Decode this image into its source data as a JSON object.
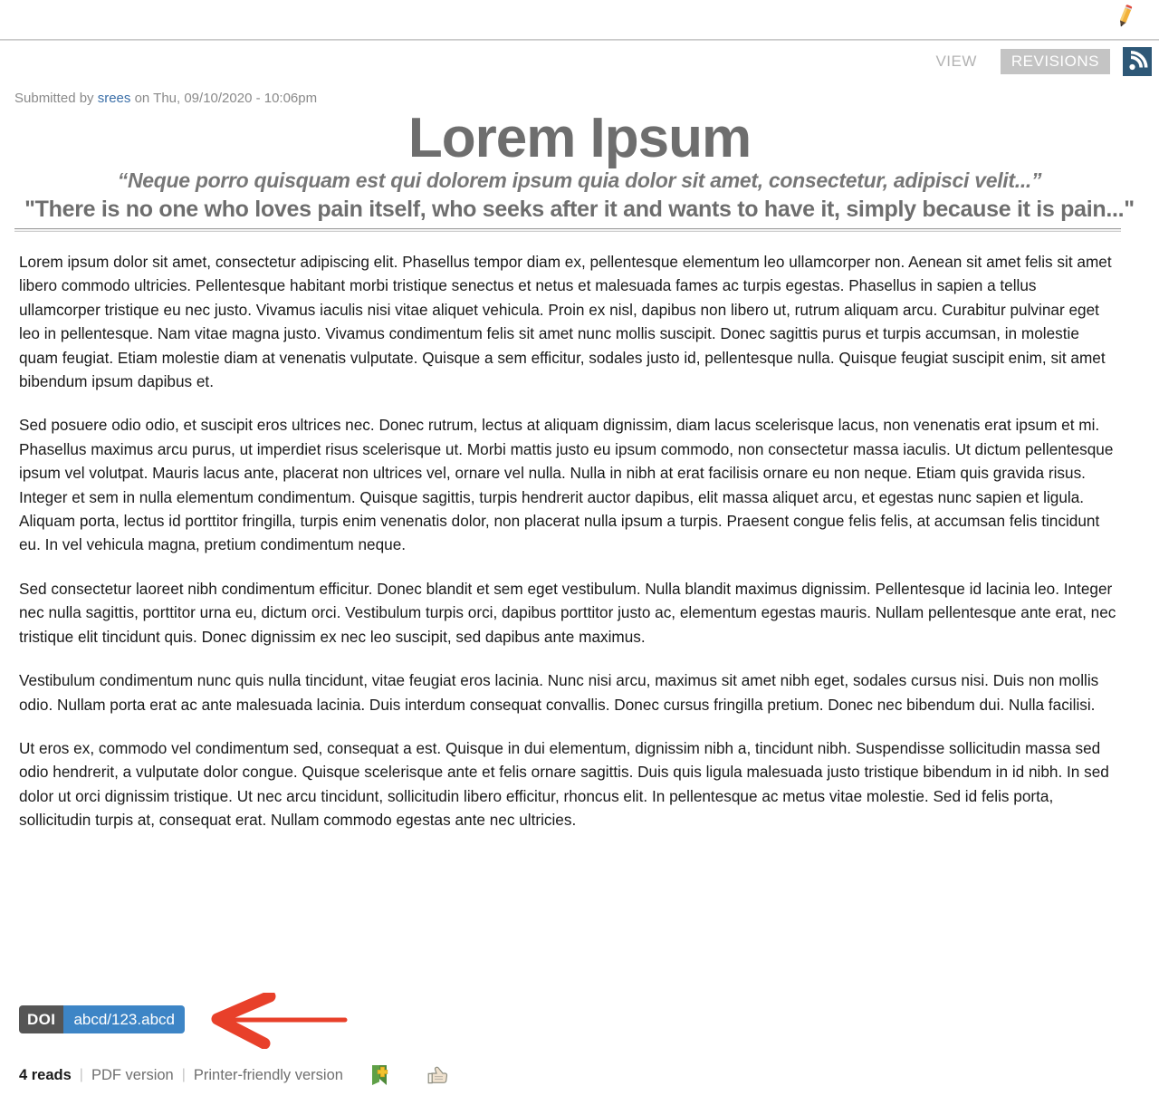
{
  "toolbar": {
    "edit_icon": "pencil-icon"
  },
  "tabs": [
    {
      "label": "VIEW",
      "active": false
    },
    {
      "label": "REVISIONS",
      "active": true
    }
  ],
  "rss": {
    "icon": "rss-icon"
  },
  "meta": {
    "submitted_prefix": "Submitted by ",
    "author": "srees",
    "submitted_suffix": " on Thu, 09/10/2020 - 10:06pm"
  },
  "article": {
    "title": "Lorem Ipsum",
    "subtitle_1": "“Neque porro quisquam est qui dolorem ipsum quia dolor sit amet, consectetur, adipisci velit...”",
    "subtitle_2": "\"There is no one who loves pain itself, who seeks after it and wants to have it, simply because it is pain...\"",
    "paragraphs": [
      "Lorem ipsum dolor sit amet, consectetur adipiscing elit. Phasellus tempor diam ex, pellentesque elementum leo ullamcorper non. Aenean sit amet felis sit amet libero commodo ultricies. Pellentesque habitant morbi tristique senectus et netus et malesuada fames ac turpis egestas. Phasellus in sapien a tellus ullamcorper tristique eu nec justo. Vivamus iaculis nisi vitae aliquet vehicula. Proin ex nisl, dapibus non libero ut, rutrum aliquam arcu. Curabitur pulvinar eget leo in pellentesque. Nam vitae magna justo. Vivamus condimentum felis sit amet nunc mollis suscipit. Donec sagittis purus et turpis accumsan, in molestie quam feugiat. Etiam molestie diam at venenatis vulputate. Quisque a sem efficitur, sodales justo id, pellentesque nulla. Quisque feugiat suscipit enim, sit amet bibendum ipsum dapibus et.",
      "Sed posuere odio odio, et suscipit eros ultrices nec. Donec rutrum, lectus at aliquam dignissim, diam lacus scelerisque lacus, non venenatis erat ipsum et mi. Phasellus maximus arcu purus, ut imperdiet risus scelerisque ut. Morbi mattis justo eu ipsum commodo, non consectetur massa iaculis. Ut dictum pellentesque ipsum vel volutpat. Mauris lacus ante, placerat non ultrices vel, ornare vel nulla. Nulla in nibh at erat facilisis ornare eu non neque. Etiam quis gravida risus. Integer et sem in nulla elementum condimentum. Quisque sagittis, turpis hendrerit auctor dapibus, elit massa aliquet arcu, et egestas nunc sapien et ligula. Aliquam porta, lectus id porttitor fringilla, turpis enim venenatis dolor, non placerat nulla ipsum a turpis. Praesent congue felis felis, at accumsan felis tincidunt eu. In vel vehicula magna, pretium condimentum neque.",
      "Sed consectetur laoreet nibh condimentum efficitur. Donec blandit et sem eget vestibulum. Nulla blandit maximus dignissim. Pellentesque id lacinia leo. Integer nec nulla sagittis, porttitor urna eu, dictum orci. Vestibulum turpis orci, dapibus porttitor justo ac, elementum egestas mauris. Nullam pellentesque ante erat, nec tristique elit tincidunt quis. Donec dignissim ex nec leo suscipit, sed dapibus ante maximus.",
      "Vestibulum condimentum nunc quis nulla tincidunt, vitae feugiat eros lacinia. Nunc nisi arcu, maximus sit amet nibh eget, sodales cursus nisi. Duis non mollis odio. Nullam porta erat ac ante malesuada lacinia. Duis interdum consequat convallis. Donec cursus fringilla pretium. Donec nec bibendum dui. Nulla facilisi.",
      "Ut eros ex, commodo vel condimentum sed, consequat a est. Quisque in dui elementum, dignissim nibh a, tincidunt nibh. Suspendisse sollicitudin massa sed odio hendrerit, a vulputate dolor congue. Quisque scelerisque ante et felis ornare sagittis. Duis quis ligula malesuada justo tristique bibendum in id nibh. In sed dolor ut orci dignissim tristique. Ut nec arcu tincidunt, sollicitudin libero efficitur, rhoncus elit. In pellentesque ac metus vitae molestie. Sed id felis porta, sollicitudin turpis at, consequat erat. Nullam commodo egestas ante nec ultricies."
    ]
  },
  "doi": {
    "label": "DOI",
    "value": "abcd/123.abcd",
    "label_color": "#555555",
    "value_color": "#3d85c6",
    "annotation_color": "#e8402a"
  },
  "footer": {
    "reads": "4 reads",
    "pdf": "PDF version",
    "printer": "Printer-friendly version",
    "separator": "|",
    "icons": [
      {
        "name": "flag-add-icon",
        "color": "#4f8a3a"
      },
      {
        "name": "thumbs-up-icon",
        "color": "#9a9a8c"
      }
    ]
  }
}
